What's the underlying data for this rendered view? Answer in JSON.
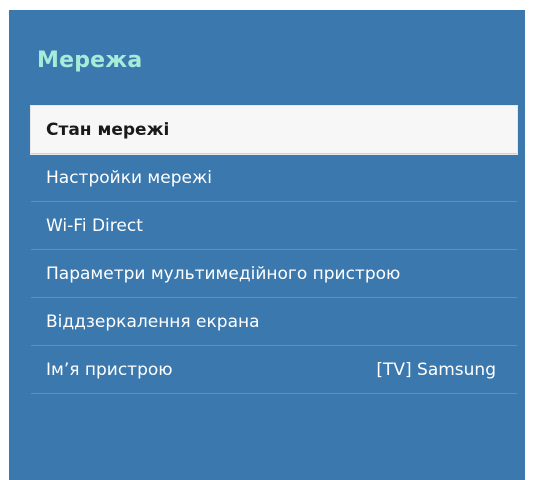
{
  "menu": {
    "title": "Мережа",
    "items": [
      {
        "label": "Стан мережі",
        "selected": true
      },
      {
        "label": "Настройки мережі"
      },
      {
        "label": "Wi-Fi Direct"
      },
      {
        "label": "Параметри мультимедійного пристрою"
      },
      {
        "label": "Віддзеркалення екрана"
      },
      {
        "label": "Ім’я пристрою",
        "value": "[TV] Samsung"
      }
    ]
  },
  "colors": {
    "panel_background": "#3a78ae",
    "title_color": "#a6ecd9",
    "selected_background": "#f7f7f7",
    "divider": "#5b90bf"
  }
}
